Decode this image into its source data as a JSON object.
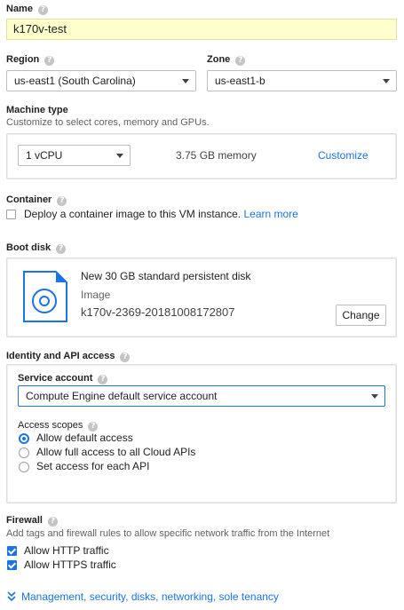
{
  "name": {
    "label": "Name",
    "value": "k170v-test"
  },
  "region": {
    "label": "Region",
    "value": "us-east1 (South Carolina)"
  },
  "zone": {
    "label": "Zone",
    "value": "us-east1-b"
  },
  "machine_type": {
    "label": "Machine type",
    "hint": "Customize to select cores, memory and GPUs.",
    "cpu_value": "1 vCPU",
    "memory": "3.75 GB memory",
    "customize_label": "Customize"
  },
  "container": {
    "label": "Container",
    "checkbox_label": "Deploy a container image to this VM instance.",
    "learn_more": "Learn more"
  },
  "boot_disk": {
    "label": "Boot disk",
    "title": "New 30 GB standard persistent disk",
    "image_label": "Image",
    "image_value": "k170v-2369-20181008172807",
    "change_label": "Change"
  },
  "identity": {
    "label": "Identity and API access",
    "service_account_label": "Service account",
    "service_account_value": "Compute Engine default service account",
    "access_scopes_label": "Access scopes",
    "scopes": [
      {
        "label": "Allow default access",
        "selected": true
      },
      {
        "label": "Allow full access to all Cloud APIs",
        "selected": false
      },
      {
        "label": "Set access for each API",
        "selected": false
      }
    ]
  },
  "firewall": {
    "label": "Firewall",
    "hint": "Add tags and firewall rules to allow specific network traffic from the Internet",
    "http_label": "Allow HTTP traffic",
    "https_label": "Allow HTTPS traffic"
  },
  "expander": {
    "label": "Management, security, disks, networking, sole tenancy"
  },
  "help_glyph": "?",
  "colors": {
    "accent": "#1a73e8",
    "name_field_bg": "#ffffcc"
  },
  "icons": [
    "help-icon",
    "dropdown-caret-icon",
    "disk-icon",
    "chevron-double-down-icon",
    "checkbox-icon",
    "radio-icon"
  ]
}
